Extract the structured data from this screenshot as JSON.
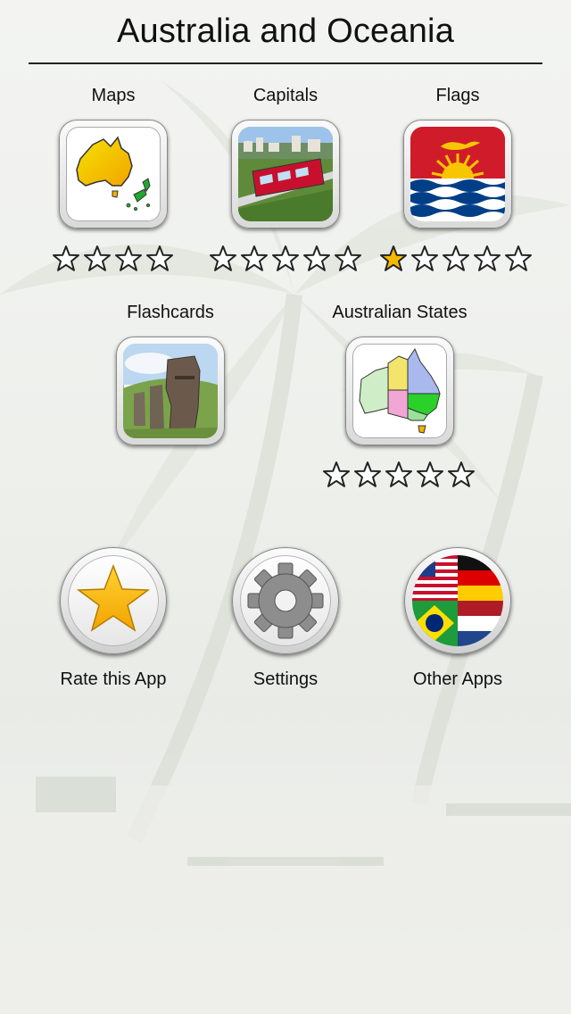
{
  "header": {
    "title": "Australia and Oceania"
  },
  "games": [
    {
      "label": "Maps",
      "icon": "australia-nz-map-icon",
      "stars_filled": 0,
      "stars_total": 4
    },
    {
      "label": "Capitals",
      "icon": "wellington-cable-car-icon",
      "stars_filled": 0,
      "stars_total": 5
    },
    {
      "label": "Flags",
      "icon": "kiribati-flag-icon",
      "stars_filled": 1,
      "stars_total": 5
    },
    {
      "label": "Flashcards",
      "icon": "easter-island-moai-icon"
    },
    {
      "label": "Australian States",
      "icon": "australian-states-map-icon",
      "stars_filled": 0,
      "stars_total": 5
    }
  ],
  "actions": [
    {
      "label": "Rate this App",
      "icon": "star-icon"
    },
    {
      "label": "Settings",
      "icon": "gear-icon"
    },
    {
      "label": "Other Apps",
      "icon": "world-flags-icon"
    }
  ],
  "colors": {
    "star_filled": "#f5b800",
    "star_outline": "#222222"
  }
}
